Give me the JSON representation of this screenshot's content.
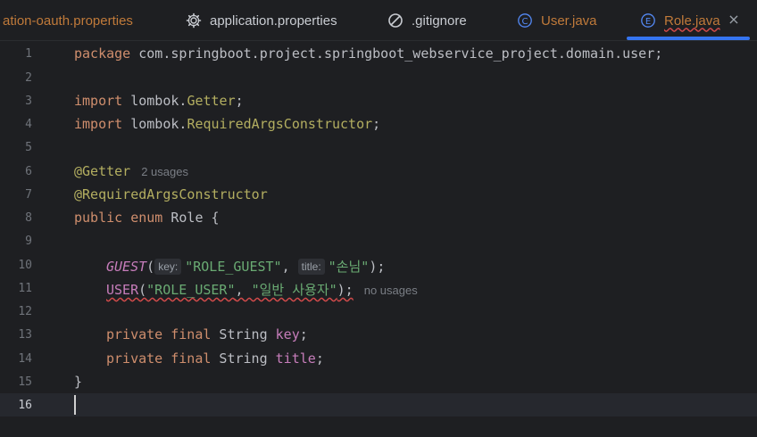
{
  "tabs": [
    {
      "label": "ation-oauth.properties"
    },
    {
      "label": "application.properties",
      "icon": "gear-icon"
    },
    {
      "label": ".gitignore",
      "icon": "ignore-icon"
    },
    {
      "label": "User.java",
      "icon": "class-icon",
      "icon_letter": "C"
    },
    {
      "label": "Role.java",
      "icon": "enum-icon",
      "icon_letter": "E"
    }
  ],
  "tab_close": "×",
  "line_numbers": [
    "1",
    "2",
    "3",
    "4",
    "5",
    "6",
    "7",
    "8",
    "9",
    "10",
    "11",
    "12",
    "13",
    "14",
    "15",
    "16"
  ],
  "code": {
    "l1_kw": "package",
    "l1_rest": " com.springboot.project.springboot_webservice_project.domain.user;",
    "l3_kw": "import",
    "l3_pkg": " lombok.",
    "l3_cls": "Getter",
    "l3_end": ";",
    "l4_kw": "import",
    "l4_pkg": " lombok.",
    "l4_cls": "RequiredArgsConstructor",
    "l4_end": ";",
    "l6_ann": "@Getter",
    "l6_usage": "2 usages",
    "l7_ann": "@RequiredArgsConstructor",
    "l8_kw": "public enum",
    "l8_rest": " Role {",
    "l10_const": "GUEST",
    "l10_open": "(",
    "l10_hint1": "key:",
    "l10_str1": "\"ROLE_GUEST\"",
    "l10_comma": ", ",
    "l10_hint2": "title:",
    "l10_str2": "\"손님\"",
    "l10_end": ");",
    "l11_const": "USER",
    "l11_open": "(",
    "l11_str1": "\"ROLE_USER\"",
    "l11_comma": ", ",
    "l11_str2": "\"일반 사용자\"",
    "l11_end": ");",
    "l11_usage": "no usages",
    "l13_kw": "private final",
    "l13_type": " String ",
    "l13_field": "key",
    "l13_end": ";",
    "l14_kw": "private final",
    "l14_type": " String ",
    "l14_field": "title",
    "l14_end": ";",
    "l15": "}"
  },
  "colors": {
    "keyword": "#cf8e6d",
    "annotation": "#b3ae60",
    "string": "#6aab73",
    "field": "#c77dbb",
    "active_tab_underline": "#3574f0",
    "error_underline": "#d04a4a"
  }
}
